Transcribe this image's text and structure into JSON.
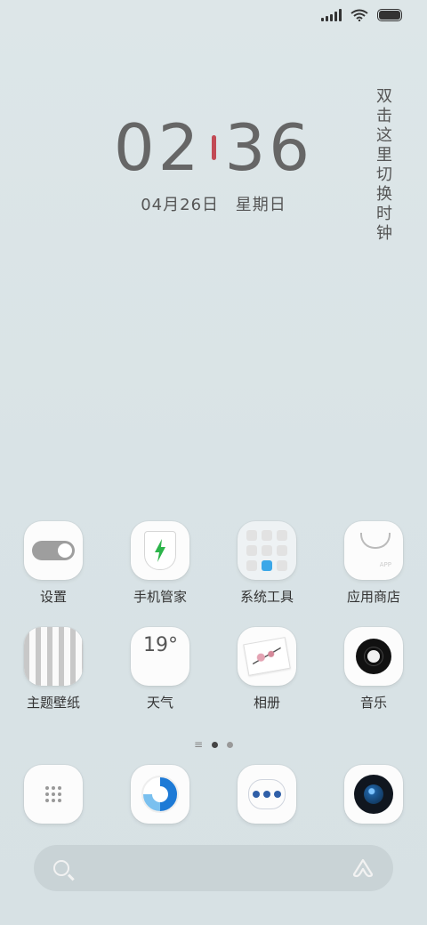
{
  "clock": {
    "hours": "02",
    "minutes": "36",
    "date": "04月26日",
    "weekday": "星期日"
  },
  "vertical_hint": "双击这里切换时钟",
  "apps": [
    {
      "label": "设置"
    },
    {
      "label": "手机管家"
    },
    {
      "label": "系统工具"
    },
    {
      "label": "应用商店",
      "tag": "APP"
    },
    {
      "label": "主题壁纸"
    },
    {
      "label": "天气",
      "temp": "19°"
    },
    {
      "label": "相册"
    },
    {
      "label": "音乐"
    }
  ],
  "pages": {
    "current": 1,
    "total": 2
  },
  "dock": [
    "phone-icon",
    "browser-icon",
    "messages-icon",
    "camera-icon"
  ],
  "colors": {
    "background": "#dbe4e7",
    "clock_accent": "#c24a55",
    "manager_bolt": "#2cb44a"
  }
}
